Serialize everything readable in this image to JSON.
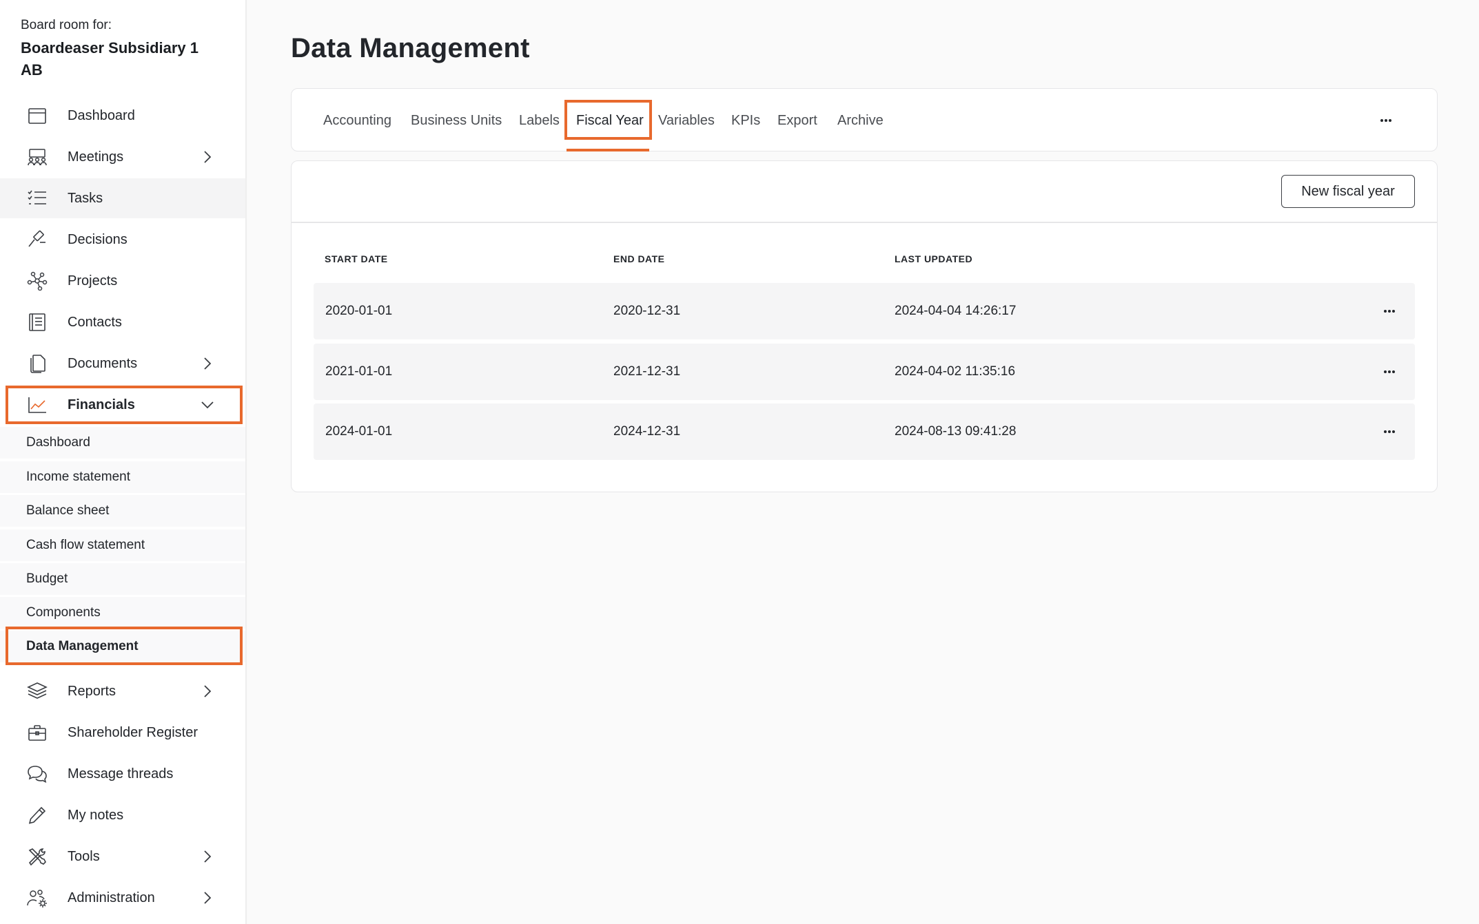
{
  "sidebar": {
    "board_label": "Board room for:",
    "board_name": "Boardeaser Subsidiary 1 AB",
    "items": [
      {
        "label": "Dashboard"
      },
      {
        "label": "Meetings"
      },
      {
        "label": "Tasks"
      },
      {
        "label": "Decisions"
      },
      {
        "label": "Projects"
      },
      {
        "label": "Contacts"
      },
      {
        "label": "Documents"
      },
      {
        "label": "Financials"
      },
      {
        "label": "Reports"
      },
      {
        "label": "Shareholder Register"
      },
      {
        "label": "Message threads"
      },
      {
        "label": "My notes"
      },
      {
        "label": "Tools"
      },
      {
        "label": "Administration"
      }
    ],
    "financials_sub": [
      {
        "label": "Dashboard"
      },
      {
        "label": "Income statement"
      },
      {
        "label": "Balance sheet"
      },
      {
        "label": "Cash flow statement"
      },
      {
        "label": "Budget"
      },
      {
        "label": "Components"
      },
      {
        "label": "Data Management"
      }
    ]
  },
  "main": {
    "title": "Data Management",
    "tabs": [
      {
        "label": "Accounting"
      },
      {
        "label": "Business Units"
      },
      {
        "label": "Labels"
      },
      {
        "label": "Fiscal Year"
      },
      {
        "label": "Variables"
      },
      {
        "label": "KPIs"
      },
      {
        "label": "Export"
      },
      {
        "label": "Archive"
      }
    ],
    "active_tab": "Fiscal Year",
    "new_button": "New fiscal year",
    "table": {
      "headers": [
        "START DATE",
        "END DATE",
        "LAST UPDATED"
      ],
      "rows": [
        [
          "2020-01-01",
          "2020-12-31",
          "2024-04-04 14:26:17"
        ],
        [
          "2021-01-01",
          "2021-12-31",
          "2024-04-02 11:35:16"
        ],
        [
          "2024-01-01",
          "2024-12-31",
          "2024-08-13 09:41:28"
        ]
      ]
    }
  },
  "colors": {
    "accent": "#e8692d",
    "text": "#23262b",
    "row_bg": "#f5f5f6"
  },
  "icons": [
    "calendar-icon",
    "meetings-icon",
    "tasks-icon",
    "gavel-icon",
    "network-icon",
    "contacts-icon",
    "documents-icon",
    "chart-icon",
    "layers-icon",
    "briefcase-icon",
    "chat-icon",
    "pencil-icon",
    "tools-icon",
    "users-gear-icon",
    "chevron-right-icon",
    "chevron-down-icon",
    "more-icon"
  ]
}
